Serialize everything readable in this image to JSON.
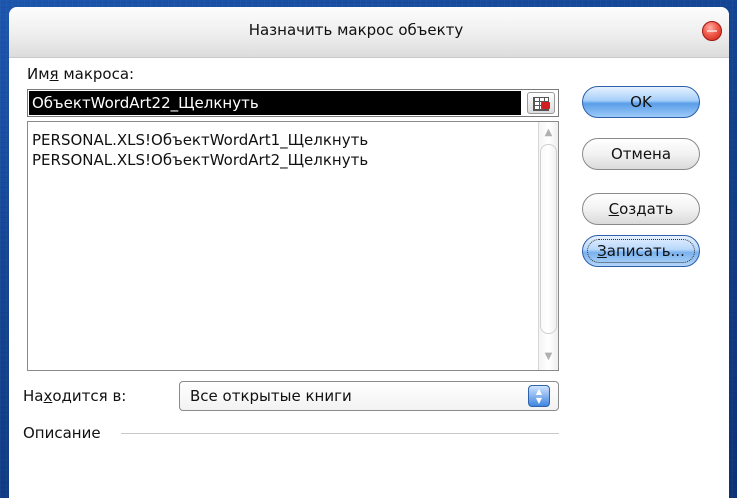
{
  "window": {
    "title": "Назначить макрос объекту"
  },
  "macro_name": {
    "label_before": "Им",
    "label_mnemonic": "я",
    "label_after": " макроса:",
    "value": "ОбъектWordArt22_Щелкнуть"
  },
  "macro_list": {
    "items": [
      "PERSONAL.XLS!ОбъектWordArt1_Щелкнуть",
      "PERSONAL.XLS!ОбъектWordArt2_Щелкнуть"
    ]
  },
  "buttons": {
    "ok": "OK",
    "cancel": "Отмена",
    "create_mnemonic": "С",
    "create_rest": "оздать",
    "record_mnemonic": "З",
    "record_rest": "аписать..."
  },
  "location": {
    "label_before": "На",
    "label_mnemonic": "х",
    "label_after": "одится в:",
    "value": "Все открытые книги"
  },
  "description": {
    "label": "Описание"
  },
  "colors": {
    "desktop_background": "#123f8c",
    "selection": "#000000",
    "close_button": "#e0403a",
    "default_button": "#5a9ee8"
  }
}
